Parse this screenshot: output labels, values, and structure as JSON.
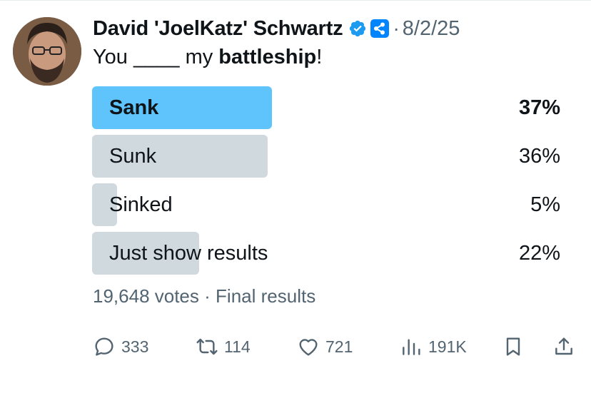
{
  "tweet": {
    "author_name": "David 'JoelKatz' Schwartz",
    "separator": "·",
    "date": "8/2/25",
    "text_prefix": "You ____ my ",
    "text_bold": "battleship",
    "text_suffix": "!"
  },
  "poll": {
    "options": [
      {
        "label": "Sank",
        "percent_text": "37%",
        "percent": 37,
        "winner": true
      },
      {
        "label": "Sunk",
        "percent_text": "36%",
        "percent": 36,
        "winner": false
      },
      {
        "label": "Sinked",
        "percent_text": "5%",
        "percent": 5,
        "winner": false
      },
      {
        "label": "Just show results",
        "percent_text": "22%",
        "percent": 22,
        "winner": false
      }
    ],
    "votes": "19,648 votes",
    "separator": "·",
    "status": "Final results"
  },
  "actions": {
    "replies": "333",
    "reposts": "114",
    "likes": "721",
    "views": "191K"
  },
  "colors": {
    "winner_bar": "#5ec4fb",
    "bar": "#cfd9de",
    "secondary_text": "#536471",
    "verified": "#1d9bf0",
    "affiliate": "#0085ff"
  },
  "icons": [
    "verified-badge-icon",
    "ripple-affiliate-icon",
    "reply-icon",
    "repost-icon",
    "like-icon",
    "views-icon",
    "bookmark-icon",
    "share-icon"
  ]
}
